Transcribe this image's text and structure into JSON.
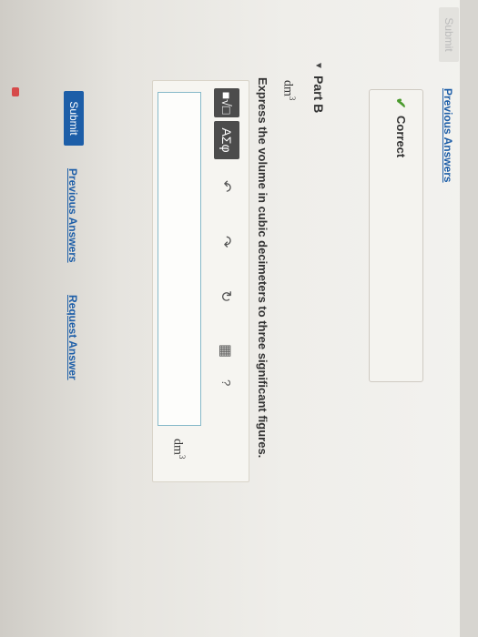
{
  "top": {
    "submit_label": "Submit",
    "previous_answers_link": "Previous Answers"
  },
  "feedback": {
    "status_text": "Correct"
  },
  "part_b": {
    "title": "Part B",
    "unit": "dm",
    "unit_exponent": "3",
    "prompt": "Express the volume in cubic decimeters to three significant figures.",
    "toolbar": {
      "templates_label": "■√□",
      "greek_label": "ΑΣφ",
      "undo_symbol": "↶",
      "redo_symbol": "↷",
      "reset_symbol": "↻",
      "keyboard_symbol": "▦",
      "help_symbol": "?"
    },
    "answer_value": "",
    "answer_unit": "dm",
    "answer_unit_exponent": "3",
    "submit_label": "Submit",
    "previous_answers_link": "Previous Answers",
    "request_answer_link": "Request Answer"
  }
}
